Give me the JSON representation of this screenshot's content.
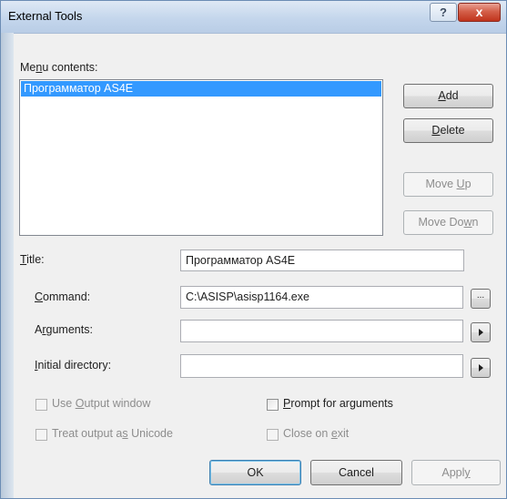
{
  "window": {
    "title": "External Tools",
    "help_glyph": "?",
    "close_glyph": "x"
  },
  "menu": {
    "label_pre": "Me",
    "label_key": "n",
    "label_post": "u contents:",
    "items": [
      "Программатор AS4E"
    ]
  },
  "buttons": {
    "add": {
      "pre": "",
      "key": "A",
      "post": "dd"
    },
    "delete": {
      "pre": "",
      "key": "D",
      "post": "elete"
    },
    "move_up": {
      "pre": "Move ",
      "key": "U",
      "post": "p"
    },
    "move_down": {
      "pre": "Move Do",
      "key": "w",
      "post": "n"
    },
    "ok": "OK",
    "cancel": "Cancel",
    "apply": {
      "pre": "Appl",
      "key": "y",
      "post": ""
    },
    "browse": "..."
  },
  "fields": {
    "title": {
      "pre": "",
      "key": "T",
      "post": "itle:",
      "value": "Программатор AS4E"
    },
    "command": {
      "pre": "",
      "key": "C",
      "post": "ommand:",
      "value": "C:\\ASISP\\asisp1164.exe"
    },
    "arguments": {
      "pre": "A",
      "key": "r",
      "post": "guments:",
      "value": ""
    },
    "initial_directory": {
      "pre": "",
      "key": "I",
      "post": "nitial directory:",
      "value": ""
    }
  },
  "options": {
    "use_output": {
      "pre": "Use ",
      "key": "O",
      "post": "utput window",
      "checked": false,
      "enabled": false
    },
    "prompt_args": {
      "pre": "",
      "key": "P",
      "post": "rompt for arguments",
      "checked": false,
      "enabled": true
    },
    "treat_unicode": {
      "pre": "Treat output a",
      "key": "s",
      "post": " Unicode",
      "checked": false,
      "enabled": false
    },
    "close_exit": {
      "pre": "Close on ",
      "key": "e",
      "post": "xit",
      "checked": false,
      "enabled": false
    }
  }
}
